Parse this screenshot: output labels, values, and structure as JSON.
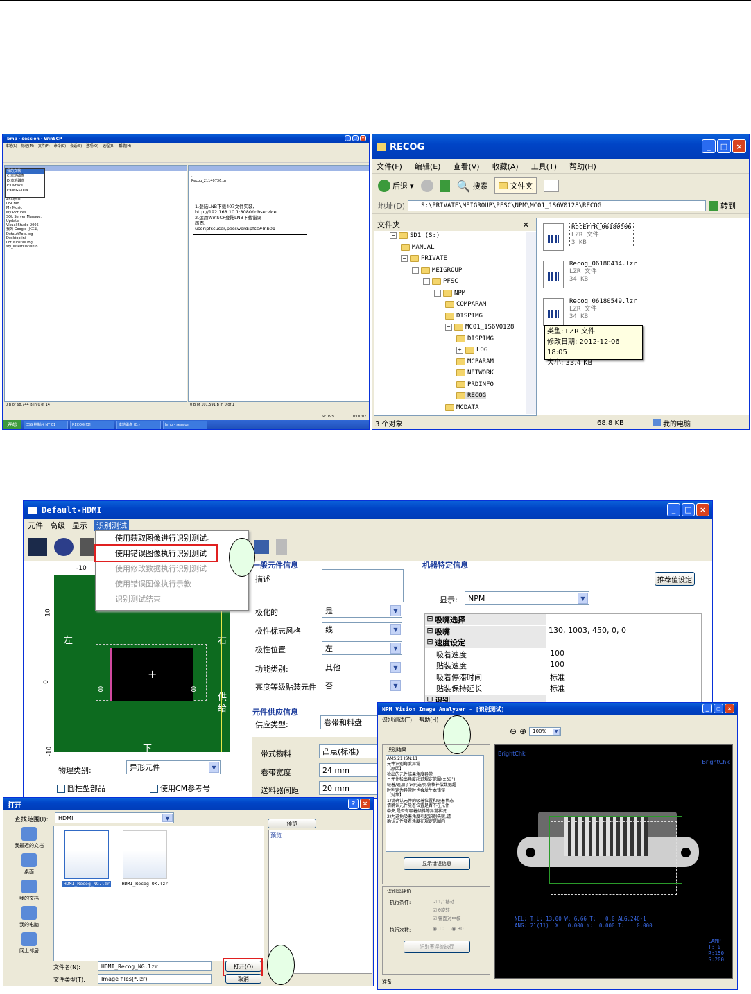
{
  "winscp": {
    "title": "bmp - session - WinSCP",
    "menu": [
      "本地(L)",
      "标记(M)",
      "文件(F)",
      "命令(C)",
      "会话(S)",
      "选项(O)",
      "远程(R)",
      "帮助(H)"
    ],
    "drive_list": [
      "我的文档",
      "C:本地磁盘",
      "D:本地磁盘",
      "E:DVtake",
      "F:KINGSTON"
    ],
    "local_files": [
      "Analysis",
      "DSCrad",
      "My Music",
      "My Pictures",
      "SQL Server Manage..",
      "Update",
      "Visual Studio 2005",
      "我的 Google 小工具",
      "DefaultRole.log",
      "Desktop.ini",
      "LotusInstall.log",
      "sql_InsertDataInfo.."
    ],
    "remote_path": "bmp",
    "remote_files": [
      "..",
      "Recog_21140736.lzr"
    ],
    "note_lines": [
      "1.登陆LNB下载407文件实装,",
      "http://192.168.10.1:8080/lnbservice",
      "2.运用WinSCP登陆LNB下载错误",
      "画面.",
      "user:pfscuser,password:pfsc#lnb01"
    ],
    "status_left": "0 B of 68,744 B in 0 of 14",
    "status_right": "0 B of 101,591 B in 0 of 1",
    "sftp": "SFTP-3",
    "time": "0:01:07",
    "taskbar_start": "开始",
    "taskbar_items": [
      "DSS 控制台 NT 01",
      "RECOG [3]",
      "本地磁盘 (C:)",
      "bmp - session"
    ]
  },
  "explorer": {
    "title": "RECOG",
    "menu": [
      "文件(F)",
      "编辑(E)",
      "查看(V)",
      "收藏(A)",
      "工具(T)",
      "帮助(H)"
    ],
    "back": "后退",
    "search": "搜索",
    "folders_btn": "文件夹",
    "address_label": "地址(D)",
    "address": "S:\\PRIVATE\\MEIGROUP\\PFSC\\NPM\\MC01_1S6V0128\\RECOG",
    "go": "转到",
    "folders_pane_title": "文件夹",
    "tree": [
      "SD1 (S:)",
      "MANUAL",
      "PRIVATE",
      "MEIGROUP",
      "PFSC",
      "NPM",
      "COMPARAM",
      "DISPIMG",
      "MC01_1S6V0128",
      "DISPIMG",
      "LOG",
      "MCPARAM",
      "NETWORK",
      "PRDINFO",
      "RECOG",
      "MCDATA"
    ],
    "files": [
      {
        "name": "RecErrR_06180506",
        "type": "LZR 文件",
        "size": "3 KB"
      },
      {
        "name": "Recog_06180434.lzr",
        "type": "LZR 文件",
        "size": "34 KB"
      },
      {
        "name": "Recog_06180549.lzr",
        "type": "LZR 文件",
        "size": "34 KB"
      }
    ],
    "tooltip": [
      "类型: LZR 文件",
      "修改日期: 2012-12-06 18:05",
      "大小: 33.4 KB"
    ],
    "status_count": "3 个对象",
    "status_size": "68.8 KB",
    "status_location": "我的电脑"
  },
  "hdmi": {
    "title": "Default-HDMI",
    "menu": [
      "元件",
      "高级",
      "显示",
      "识别测试"
    ],
    "dropdown_items": [
      "使用获取图像进行识别测试。",
      "使用错误图像执行识别测试",
      "使用修改数据执行识别测试",
      "使用错误图像执行示教",
      "识别测试结束"
    ],
    "ruler_label": "-10",
    "left_label": "左",
    "right_label": "右",
    "bottom_label": "下",
    "feed_label": "供给",
    "v_ruler": [
      "10",
      "0",
      "-10"
    ],
    "physical_type_label": "物理类别:",
    "physical_type": "异形元件",
    "cylinder_label": "圆柱型部品",
    "cm_ref_label": "使用CM参考号",
    "general_info": "一般元件信息",
    "desc_label": "描述",
    "polarized_label": "极化的",
    "polarized": "是",
    "polarity_mark_label": "极性标志风格",
    "polarity_mark": "线",
    "polarity_pos_label": "极性位置",
    "polarity_pos": "左",
    "func_type_label": "功能类别:",
    "func_type": "其他",
    "brightness_label": "亮度等级贴装元件",
    "brightness": "否",
    "supply_info": "元件供应信息",
    "supply_type_label": "供应类型:",
    "supply_type": "卷带和料盘",
    "tape_material_label": "带式物料",
    "tape_material": "凸点(标准)",
    "tape_width_label": "卷带宽度",
    "tape_width": "24 mm",
    "feeder_pitch_label": "送料器间距",
    "feeder_pitch": "20 mm",
    "machine_info": "机器特定信息",
    "recommend_btn": "推荐值设定",
    "display_label": "显示:",
    "display_value": "NPM",
    "grid": [
      {
        "k": "吸嘴选择",
        "v": "",
        "group": true
      },
      {
        "k": "吸嘴",
        "v": "130, 1003, 450, 0, 0",
        "group": true
      },
      {
        "k": "速度设定",
        "v": "",
        "group": true
      },
      {
        "k": "吸着速度",
        "v": "100",
        "group": false
      },
      {
        "k": "贴装速度",
        "v": "100",
        "group": false
      },
      {
        "k": "吸着停滞时间",
        "v": "标准",
        "group": false
      },
      {
        "k": "贴装保持延长",
        "v": "标准",
        "group": false
      },
      {
        "k": "识别",
        "v": "",
        "group": true
      }
    ]
  },
  "open_dialog": {
    "title": "打开",
    "look_in_label": "查找范围(I):",
    "look_in": "HDMI",
    "places": [
      "我最近的文档",
      "桌面",
      "我的文档",
      "我的电脑",
      "网上邻居"
    ],
    "files": [
      "HDMI_Recog_NG.lzr",
      "HDMI_Recog-OK.lzr"
    ],
    "preview_btn": "预览",
    "preview_label": "预览",
    "filename_label": "文件名(N):",
    "filename": "HDMI_Recog_NG.lzr",
    "filetype_label": "文件类型(T):",
    "filetype": "Image files(*.lzr)",
    "open_btn": "打开(O)",
    "cancel_btn": "取消"
  },
  "analyzer": {
    "title": "NPM Vision Image Analyzer - [识别测试]",
    "menu": [
      "识别测试(T)",
      "帮助(H)"
    ],
    "zoom": "100%",
    "result_title": "识别结果",
    "result_lines": [
      "AMS:21 ISN:11",
      "元件识别角度异常",
      "【原因】",
      "检出的元件结果角度异常",
      "・元件检出角度超过规定范围(±30°)",
      "吸着/追加了识别选项,偏移补偿数据超",
      "时判定为异常时也会发生本错误",
      "【对策】",
      "1)请确认元件的吸着位置和吸着状态",
      "请确认元件吸着位置是否不在元件",
      "中央,是否有吸着倾斜等异常状况",
      "2)为避免吸着角度引起识别失败,请",
      "确认元件吸着角度在规定范围内"
    ],
    "detail_btn": "显示错误信息",
    "eval_title": "识别率评价",
    "exec_cond_label": "执行条件:",
    "cond_options": [
      "1/1移动",
      "θ旋转",
      "镜面对中校"
    ],
    "exec_count_label": "执行次数:",
    "count_options": [
      "10",
      "30"
    ],
    "eval_btn": "识别率评价执行",
    "status": "准备",
    "image_labels": [
      "BrightChk",
      "BrightChk"
    ],
    "image_stats": [
      "NEL: T.L: 13.00 W: 6.66 T:   0.0 ALG:246-1",
      "ANG: 21(11)  X:  0.000 Y:  0.000 T:    0.000"
    ],
    "lamp_lines": [
      "LAMP",
      "T:  0",
      "R:150",
      "S:200"
    ]
  },
  "callouts": [
    "",
    "",
    ""
  ]
}
